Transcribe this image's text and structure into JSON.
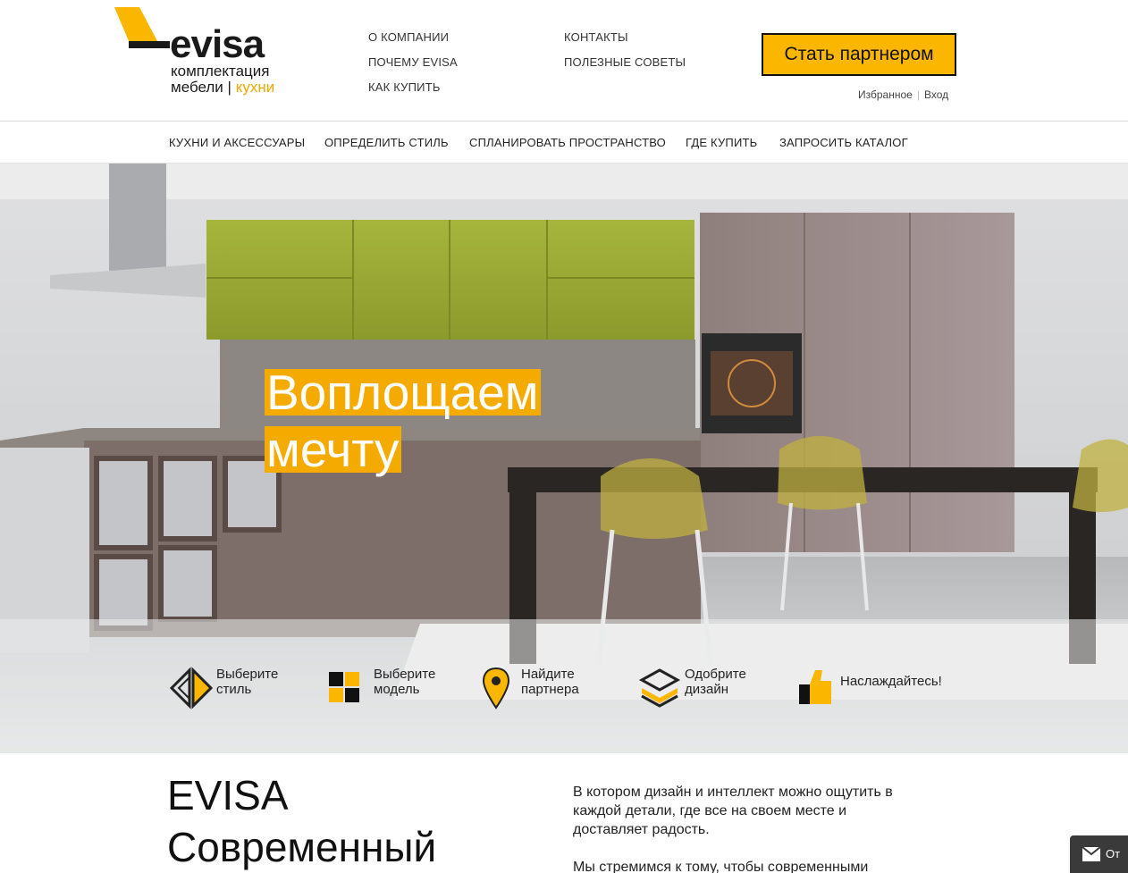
{
  "logo": {
    "wordmark": "evisa",
    "line1": "комплектация",
    "line2_a": "мебели",
    "line2_sep": "|",
    "line2_b": "кухни"
  },
  "top_nav": {
    "col1": [
      "О КОМПАНИИ",
      "ПОЧЕМУ EVISA",
      "КАК КУПИТЬ"
    ],
    "col2": [
      "КОНТАКТЫ",
      "ПОЛЕЗНЫЕ СОВЕТЫ"
    ]
  },
  "partner_button": "Стать партнером",
  "account": {
    "favorites": "Избранное",
    "separator": "|",
    "login": "Вход"
  },
  "main_nav": [
    "КУХНИ И АКСЕССУАРЫ",
    "ОПРЕДЕЛИТЬ СТИЛЬ",
    "СПЛАНИРОВАТЬ ПРОСТРАНСТВО",
    "ГДЕ КУПИТЬ",
    "ЗАПРОСИТЬ КАТАЛОГ"
  ],
  "hero": {
    "headline_line1": "Воплощаем",
    "headline_line2": "мечту"
  },
  "steps": [
    {
      "label": "Выберите\nстиль",
      "icon": "style-icon"
    },
    {
      "label": "Выберите\nмодель",
      "icon": "model-icon"
    },
    {
      "label": "Найдите\nпартнера",
      "icon": "location-pin-icon"
    },
    {
      "label": "Одобрите\nдизайн",
      "icon": "layers-icon"
    },
    {
      "label": "Наслаждайтесь!",
      "icon": "thumbs-up-icon"
    }
  ],
  "about": {
    "title": "EVISA",
    "subtitle": "Современный",
    "paragraph1": "В котором дизайн и интеллект можно ощутить в каждой детали, где все на своем месте и доставляет радость.",
    "paragraph2": "Мы стремимся к тому, чтобы современными"
  },
  "feedback_button": "От",
  "colors": {
    "accent": "#fbb600",
    "text": "#222222",
    "header_border": "#d9d9d9"
  }
}
